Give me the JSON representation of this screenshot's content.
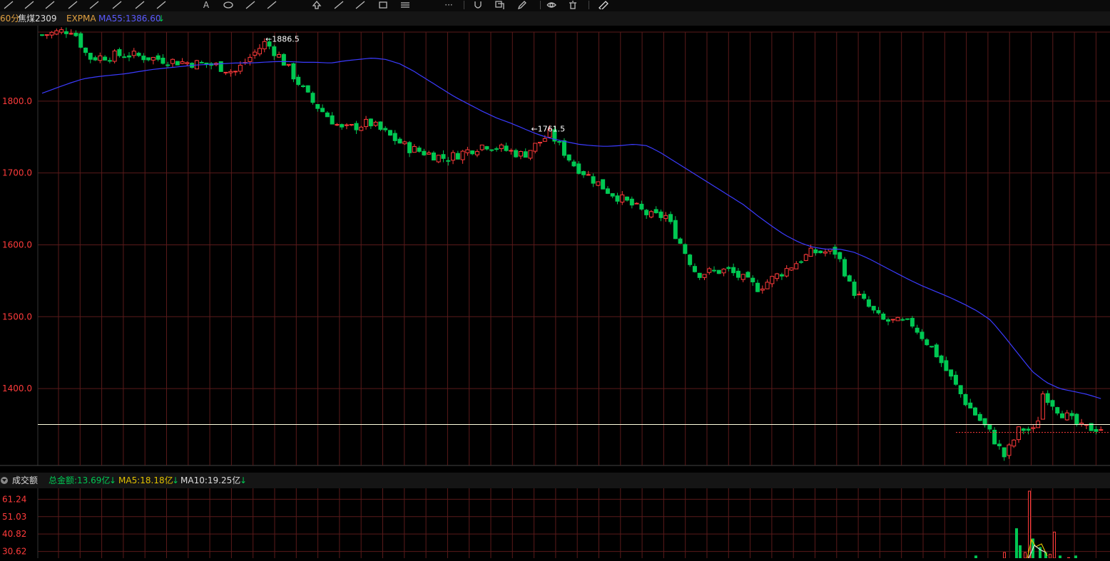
{
  "toolbar": {
    "icons": [
      "line-tool-icon",
      "ray-tool-icon",
      "curve-tool-icon",
      "parallel-channel-icon",
      "pitchfork-icon",
      "fibonacci-icon",
      "gann-fan-icon",
      "measure-icon",
      "text-tool-icon",
      "ellipse-tool-icon",
      "wave-tool-icon",
      "magnet-draw-icon",
      "arrow-up-icon",
      "arrow-marker-icon",
      "cursor-mark-icon",
      "rectangle-tool-icon",
      "sliders-icon",
      "more-icon",
      "magnet-icon",
      "copy-icon",
      "pencil-icon",
      "eye-icon",
      "trash-icon",
      "ruler-icon"
    ],
    "more_label": "···"
  },
  "info": {
    "period": "60分",
    "symbol": "焦煤2309",
    "indicator": "EXPMA",
    "ma_label": "MA55:1386.60",
    "ma_arrow": "↓"
  },
  "volume_bar": {
    "title": "成交额",
    "total": "总金额:13.69亿",
    "total_arrow": "↓",
    "ma5": "MA5:18.18亿",
    "ma5_arrow": "↓",
    "ma10": "MA10:19.25亿",
    "ma10_arrow": "↓"
  },
  "colors": {
    "up": "#ff3b3b",
    "down": "#00c853",
    "ma55": "#3b3bff",
    "grid": "#5a1a1a",
    "axis_text": "#ff3b3b",
    "crosshair": "#ffffe0"
  },
  "chart_data": {
    "type": "candlestick",
    "y_ticks": [
      "1800.0",
      "1700.0",
      "1600.0",
      "1500.0",
      "1400.0"
    ],
    "y_tick_values": [
      1800,
      1700,
      1600,
      1500,
      1400
    ],
    "ylim": [
      1293,
      1905
    ],
    "annotations": [
      {
        "text": "←1886.5",
        "value": 1886.5,
        "bar_index": 58
      },
      {
        "text": "←1761.5",
        "value": 1761.5,
        "bar_index": 127
      }
    ],
    "horizontal_line": 1350,
    "ma55_series": [
      1811,
      1818,
      1825,
      1831,
      1834,
      1836,
      1838,
      1841,
      1844,
      1846,
      1848,
      1850,
      1851,
      1852,
      1853,
      1853,
      1854,
      1855,
      1855,
      1854,
      1854,
      1853,
      1856,
      1858,
      1860,
      1858,
      1852,
      1842,
      1830,
      1818,
      1806,
      1796,
      1786,
      1777,
      1770,
      1762,
      1754,
      1748,
      1744,
      1740,
      1738,
      1737,
      1738,
      1740,
      1738,
      1728,
      1716,
      1704,
      1692,
      1680,
      1668,
      1656,
      1641,
      1627,
      1614,
      1604,
      1597,
      1594,
      1594,
      1590,
      1582,
      1572,
      1562,
      1552,
      1543,
      1535,
      1527,
      1518,
      1508,
      1495,
      1472,
      1448,
      1424,
      1409,
      1400,
      1396,
      1392,
      1386
    ],
    "volume_axis": [
      "61.24",
      "51.03",
      "40.82",
      "30.62"
    ],
    "volume_ylim": [
      25,
      66
    ]
  }
}
